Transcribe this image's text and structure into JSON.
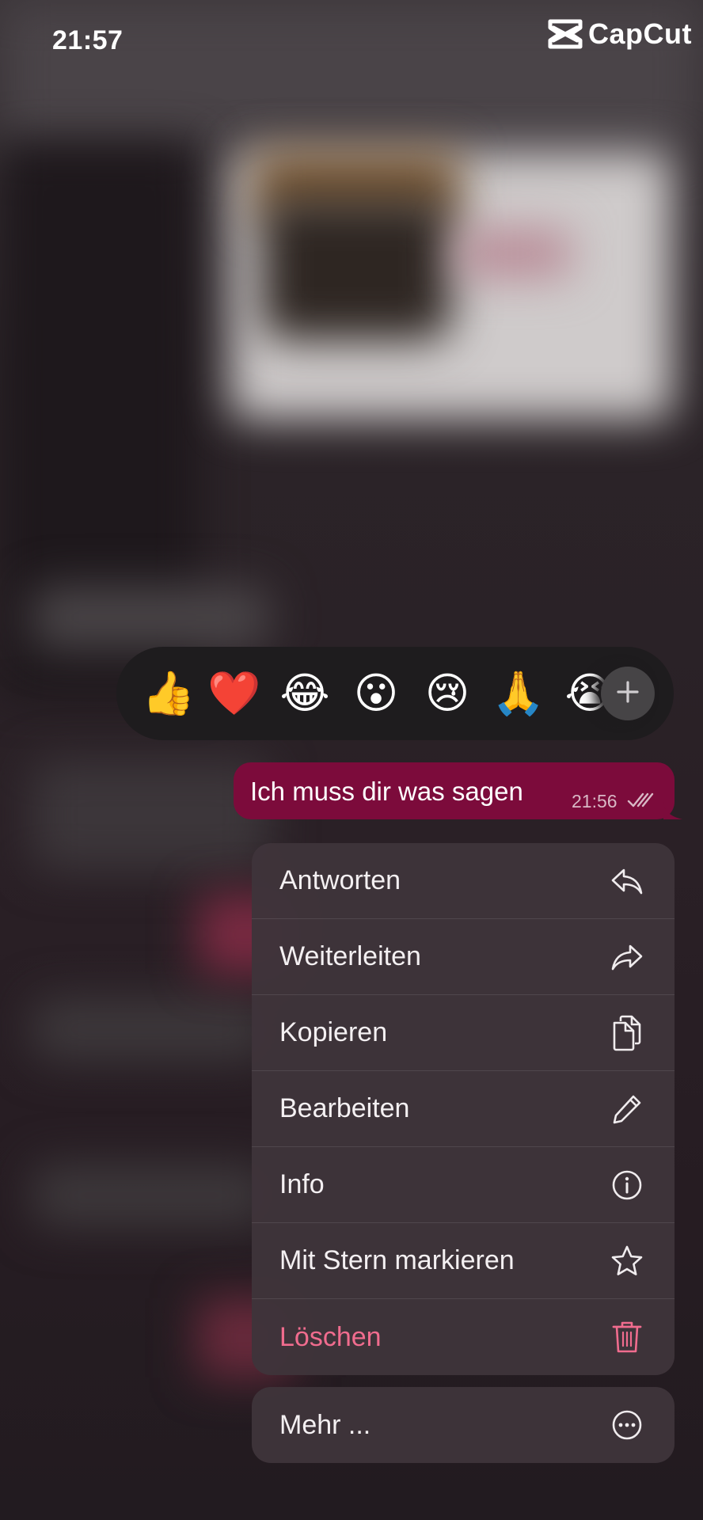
{
  "status_bar": {
    "time": "21:57"
  },
  "watermark": {
    "text": "CapCut"
  },
  "reactions": {
    "items": [
      {
        "emoji": "👍",
        "icon": "thumbs-up"
      },
      {
        "emoji": "❤️",
        "icon": "red-heart"
      },
      {
        "emoji": "😂",
        "icon": "face-with-tears-of-joy"
      },
      {
        "emoji": "😮",
        "icon": "face-with-open-mouth"
      },
      {
        "emoji": "😢",
        "icon": "crying-face"
      },
      {
        "emoji": "🙏",
        "icon": "folded-hands"
      },
      {
        "emoji": "😭",
        "icon": "loudly-crying-face"
      }
    ],
    "more_icon": "plus-icon"
  },
  "message": {
    "text": "Ich muss dir was sagen",
    "time": "21:56",
    "status_icon": "double-check-icon",
    "bubble_color": "#7c0b3b"
  },
  "menu": {
    "items": [
      {
        "label": "Antworten",
        "icon": "reply-icon"
      },
      {
        "label": "Weiterleiten",
        "icon": "forward-icon"
      },
      {
        "label": "Kopieren",
        "icon": "copy-icon"
      },
      {
        "label": "Bearbeiten",
        "icon": "pencil-icon"
      },
      {
        "label": "Info",
        "icon": "info-icon"
      },
      {
        "label": "Mit Stern markieren",
        "icon": "star-icon"
      },
      {
        "label": "Löschen",
        "icon": "trash-icon",
        "danger": true
      }
    ],
    "more": {
      "label": "Mehr ...",
      "icon": "more-dots-icon"
    },
    "danger_color": "#f06c8e"
  }
}
